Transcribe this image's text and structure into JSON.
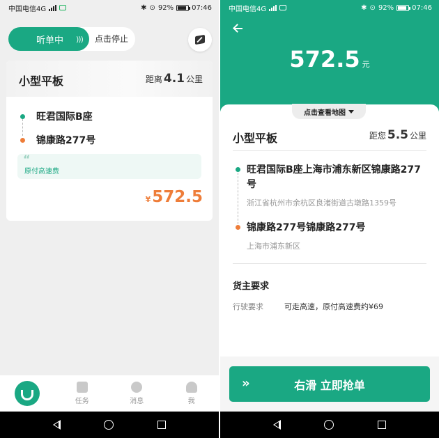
{
  "status_bar": {
    "carrier": "中国电信4G",
    "battery": "92%",
    "time": "07:46"
  },
  "left": {
    "listen_label": "听单中",
    "stop_label": "点击停止",
    "order": {
      "vehicle_type": "小型平板",
      "distance_prefix": "距离",
      "distance_value": "4.1",
      "distance_unit": "公里",
      "origin": "旺君国际B座",
      "destination": "锦康路277号",
      "fee_note": "原付高速费",
      "currency": "¥",
      "price": "572.5"
    },
    "tabs": [
      {
        "label": ""
      },
      {
        "label": "任务"
      },
      {
        "label": "消息"
      },
      {
        "label": "我"
      }
    ]
  },
  "right": {
    "price": "572.5",
    "price_unit": "元",
    "map_link": "点击查看地图",
    "vehicle_type": "小型平板",
    "distance_prefix": "距您",
    "distance_value": "5.5",
    "distance_unit": "公里",
    "origin_name": "旺君国际B座上海市浦东新区锦康路277号",
    "origin_address": "浙江省杭州市余杭区良渚街道古墩路1359号",
    "destination_name": "锦康路277号锦康路277号",
    "destination_address": "上海市浦东新区",
    "requirements_title": "货主要求",
    "drive_req_label": "行驶要求",
    "drive_req_value": "可走高速，原付高速费约¥69",
    "grab_button": "右滑 立即抢单"
  },
  "colors": {
    "brand_green": "#1aa883",
    "accent_orange": "#ee7d39"
  },
  "icons": {
    "map_button": "map-icon",
    "home_tab": "didi-logo-icon",
    "task_tab": "task-icon",
    "message_tab": "chat-icon",
    "me_tab": "person-icon",
    "back": "arrow-left-icon"
  }
}
